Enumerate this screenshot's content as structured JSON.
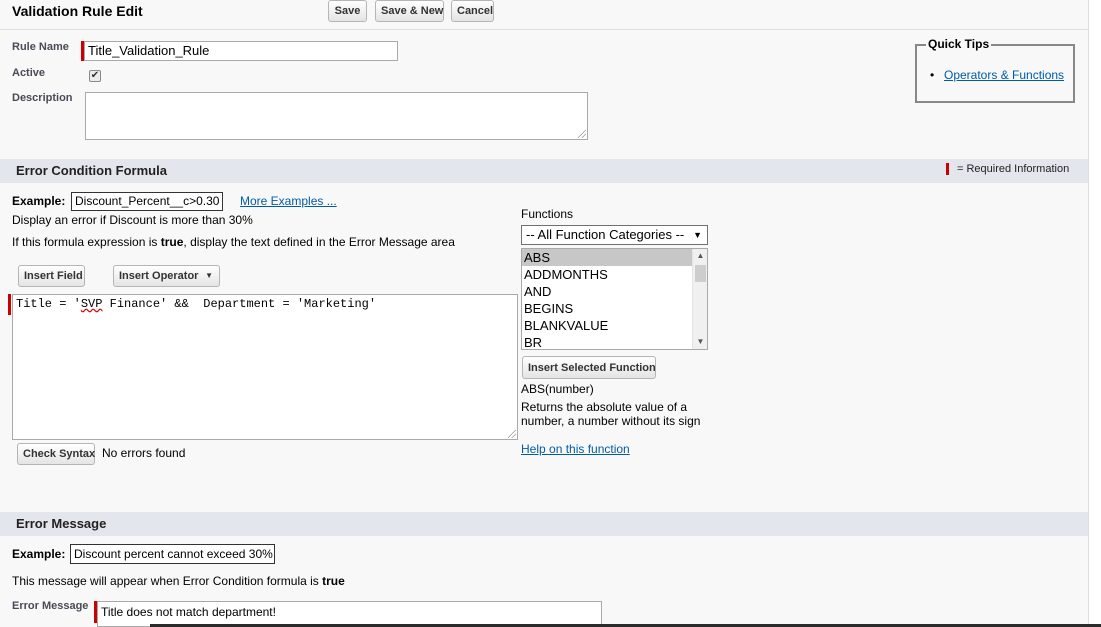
{
  "header": {
    "title": "Validation Rule Edit",
    "save_label": "Save",
    "save_new_label": "Save & New",
    "cancel_label": "Cancel"
  },
  "rule": {
    "name_label": "Rule Name",
    "name_value": "Title_Validation_Rule",
    "active_label": "Active",
    "active_checked": true,
    "description_label": "Description",
    "description_value": ""
  },
  "quick_tips": {
    "title": "Quick Tips",
    "link": "Operators & Functions"
  },
  "error_condition": {
    "section_title": "Error Condition Formula",
    "required_legend": "= Required Information",
    "example_label": "Example:",
    "example_value": "Discount_Percent__c>0.30",
    "more_examples": "More Examples ...",
    "example_desc": "Display an error if Discount is more than 30%",
    "info_prefix": "If this formula expression is ",
    "info_bold": "true",
    "info_suffix": ", display the text defined in the Error Message area",
    "insert_field_label": "Insert Field",
    "insert_operator_label": "Insert Operator",
    "formula_part1": "Title = '",
    "formula_squiggle": "SVP",
    "formula_part2": " Finance' &&  Department = 'Marketing'",
    "check_syntax_label": "Check Syntax",
    "syntax_status": "No errors found"
  },
  "functions": {
    "label": "Functions",
    "category_selected": "-- All Function Categories --",
    "items": [
      "ABS",
      "ADDMONTHS",
      "AND",
      "BEGINS",
      "BLANKVALUE",
      "BR"
    ],
    "selected_index": 0,
    "insert_label": "Insert Selected Function",
    "signature": "ABS(number)",
    "description": "Returns the absolute value of a number, a number without its sign",
    "help_link": "Help on this function"
  },
  "error_message": {
    "section_title": "Error Message",
    "example_label": "Example:",
    "example_value": "Discount percent cannot exceed 30%",
    "info_prefix": "This message will appear when Error Condition formula is ",
    "info_bold": "true",
    "field_label": "Error Message",
    "field_value": "Title does not match department!"
  },
  "colors": {
    "required": "#cc0000",
    "section_bg": "#e3e6ec",
    "link": "#015ba7"
  }
}
